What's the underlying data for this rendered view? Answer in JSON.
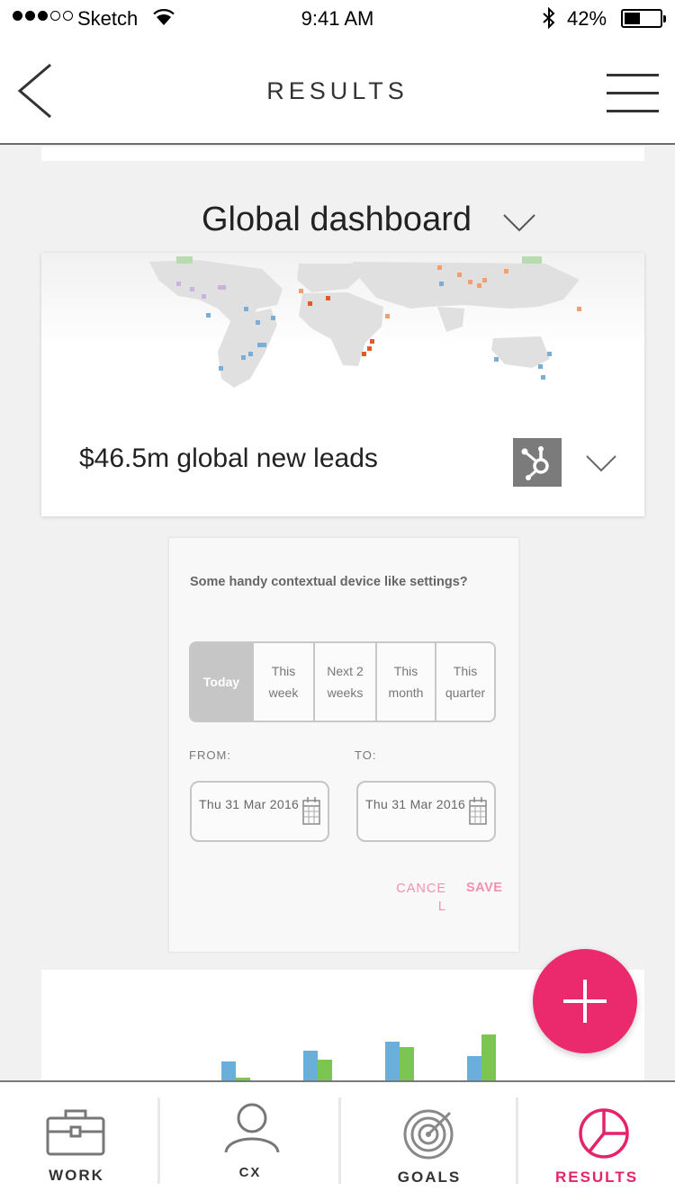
{
  "status_bar": {
    "carrier": "Sketch",
    "time": "9:41 AM",
    "battery": "42%"
  },
  "nav": {
    "title": "RESULTS"
  },
  "dashboard": {
    "title": "Global dashboard"
  },
  "map_card": {
    "metric": "$46.5m global new leads",
    "source_icon": "hubspot-icon"
  },
  "settings_popup": {
    "question": "Some handy contextual device like settings?",
    "ranges": [
      {
        "label": "Today",
        "active": true
      },
      {
        "label": "This\nweek",
        "active": false
      },
      {
        "label": "Next 2\nweeks",
        "active": false
      },
      {
        "label": "This\nmonth",
        "active": false
      },
      {
        "label": "This\nquarter",
        "active": false
      }
    ],
    "from_label": "FROM:",
    "to_label": "TO:",
    "from_date": "Thu 31 Mar 2016",
    "to_date": "Thu 31 Mar 2016",
    "cancel_label": "CANCEL",
    "save_label": "SAVE",
    "accent_color": "#f48fb1"
  },
  "chart_data": {
    "type": "bar",
    "categories": [
      "",
      "",
      "",
      ""
    ],
    "series": [
      {
        "values": [
          38,
          50,
          60,
          44
        ],
        "color": "#6aafda"
      },
      {
        "values": [
          20,
          40,
          54,
          68
        ],
        "color": "#7cc552"
      }
    ]
  },
  "fab": {
    "icon": "plus-icon",
    "color": "#eb2a6d"
  },
  "tabs": [
    {
      "label": "WORK",
      "icon": "briefcase-icon",
      "active": false
    },
    {
      "label": "CX",
      "icon": "person-icon",
      "active": false
    },
    {
      "label": "GOALS",
      "icon": "target-icon",
      "active": false
    },
    {
      "label": "RESULTS",
      "icon": "pie-chart-icon",
      "active": true
    }
  ],
  "colors": {
    "accent": "#e5236b"
  }
}
